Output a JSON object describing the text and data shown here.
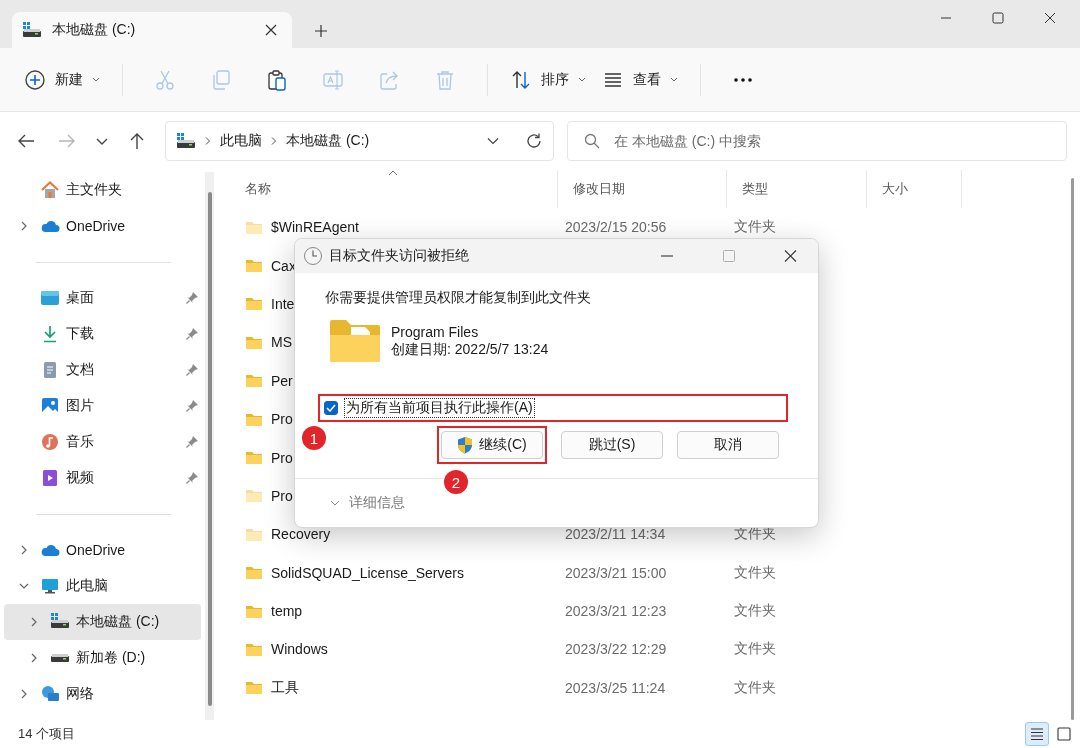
{
  "window": {
    "tab_title": "本地磁盘 (C:)"
  },
  "toolbar": {
    "items": [
      {
        "kind": "new",
        "label": "新建",
        "dropdown": true,
        "disabled": false
      },
      {
        "kind": "separator"
      },
      {
        "kind": "cut",
        "disabled": true
      },
      {
        "kind": "copy",
        "disabled": true
      },
      {
        "kind": "paste",
        "disabled": false
      },
      {
        "kind": "rename",
        "disabled": true
      },
      {
        "kind": "share",
        "disabled": true
      },
      {
        "kind": "delete",
        "disabled": true
      },
      {
        "kind": "separator"
      },
      {
        "kind": "sort",
        "label": "排序",
        "dropdown": true,
        "disabled": false
      },
      {
        "kind": "view",
        "label": "查看",
        "dropdown": true,
        "disabled": false
      },
      {
        "kind": "separator"
      },
      {
        "kind": "more",
        "disabled": false
      }
    ]
  },
  "navigation": {
    "buttons": [
      {
        "kind": "back",
        "disabled": false
      },
      {
        "kind": "forward",
        "disabled": true
      },
      {
        "kind": "recent",
        "disabled": false
      },
      {
        "kind": "up",
        "disabled": false
      }
    ],
    "path": [
      "此电脑",
      "本地磁盘 (C:)"
    ],
    "search": {
      "placeholder": "在 本地磁盘 (C:) 中搜索"
    }
  },
  "sidebar": {
    "sections": [
      [
        {
          "kind": "home",
          "label": "主文件夹",
          "selected": false
        },
        {
          "kind": "cloud",
          "label": "OneDrive",
          "expanded": false,
          "selected": false
        }
      ],
      [
        {
          "kind": "desktop",
          "label": "桌面",
          "pinned": true,
          "selected": false
        },
        {
          "kind": "download",
          "label": "下载",
          "pinned": true,
          "selected": false
        },
        {
          "kind": "documents",
          "label": "文档",
          "pinned": true,
          "selected": false
        },
        {
          "kind": "pictures",
          "label": "图片",
          "pinned": true,
          "selected": false
        },
        {
          "kind": "music",
          "label": "音乐",
          "pinned": true,
          "selected": false
        },
        {
          "kind": "videos",
          "label": "视频",
          "pinned": true,
          "selected": false
        }
      ],
      [
        {
          "kind": "cloud",
          "label": "OneDrive",
          "expanded": false,
          "selected": false
        },
        {
          "kind": "pc",
          "label": "此电脑",
          "expanded": true,
          "selected": false,
          "children": [
            {
              "kind": "system_drive",
              "label": "本地磁盘 (C:)",
              "expanded": false,
              "selected": true
            },
            {
              "kind": "drive",
              "label": "新加卷 (D:)",
              "expanded": false,
              "selected": false
            }
          ]
        },
        {
          "kind": "network",
          "label": "网络",
          "expanded": false,
          "selected": false
        }
      ]
    ]
  },
  "file_list": {
    "columns": [
      {
        "label": "名称",
        "sorted": true
      },
      {
        "label": "修改日期",
        "sorted": false
      },
      {
        "label": "类型",
        "sorted": false
      },
      {
        "label": "大小",
        "sorted": false
      }
    ],
    "rows": [
      {
        "name": "$WinREAgent",
        "date": "2023/2/15 20:56",
        "type": "文件夹",
        "hidden": true
      },
      {
        "name": "Cax",
        "hidden": false
      },
      {
        "name": "Inte",
        "hidden": false
      },
      {
        "name": "MS",
        "hidden": false
      },
      {
        "name": "Per",
        "hidden": false
      },
      {
        "name": "Pro",
        "hidden": false
      },
      {
        "name": "Pro",
        "hidden": false
      },
      {
        "name": "Pro",
        "hidden": true
      },
      {
        "name": "Recovery",
        "date": "2023/2/11 14:34",
        "type": "文件夹",
        "hidden": true
      },
      {
        "name": "SolidSQUAD_License_Servers",
        "date": "2023/3/21 15:00",
        "type": "文件夹",
        "hidden": false
      },
      {
        "name": "temp",
        "date": "2023/3/21 12:23",
        "type": "文件夹",
        "hidden": false
      },
      {
        "name": "Windows",
        "date": "2023/3/22 12:29",
        "type": "文件夹",
        "hidden": false
      },
      {
        "name": "工具",
        "date": "2023/3/25 11:24",
        "type": "文件夹",
        "hidden": false
      }
    ]
  },
  "dialog": {
    "title": "目标文件夹访问被拒绝",
    "window_buttons": [
      {
        "kind": "minimize",
        "disabled": false
      },
      {
        "kind": "maximize",
        "disabled": true
      },
      {
        "kind": "close",
        "disabled": false
      }
    ],
    "message": "你需要提供管理员权限才能复制到此文件夹",
    "item": {
      "name": "Program Files",
      "created": "创建日期: 2022/5/7 13:24"
    },
    "apply_all": {
      "label": "为所有当前项目执行此操作(A)",
      "checked": true,
      "highlighted": true,
      "marker": "1"
    },
    "buttons": [
      {
        "label": "继续(C)",
        "kind": "elevated",
        "highlighted": true,
        "marker": "2"
      },
      {
        "label": "跳过(S)",
        "kind": "plain",
        "highlighted": false
      },
      {
        "label": "取消",
        "kind": "plain",
        "highlighted": false
      }
    ],
    "details": {
      "label": "详细信息",
      "expanded": false
    }
  },
  "status_bar": {
    "item_count": "14 个项目",
    "view_modes": [
      {
        "kind": "details",
        "selected": true
      },
      {
        "kind": "tiles",
        "selected": false
      }
    ]
  }
}
